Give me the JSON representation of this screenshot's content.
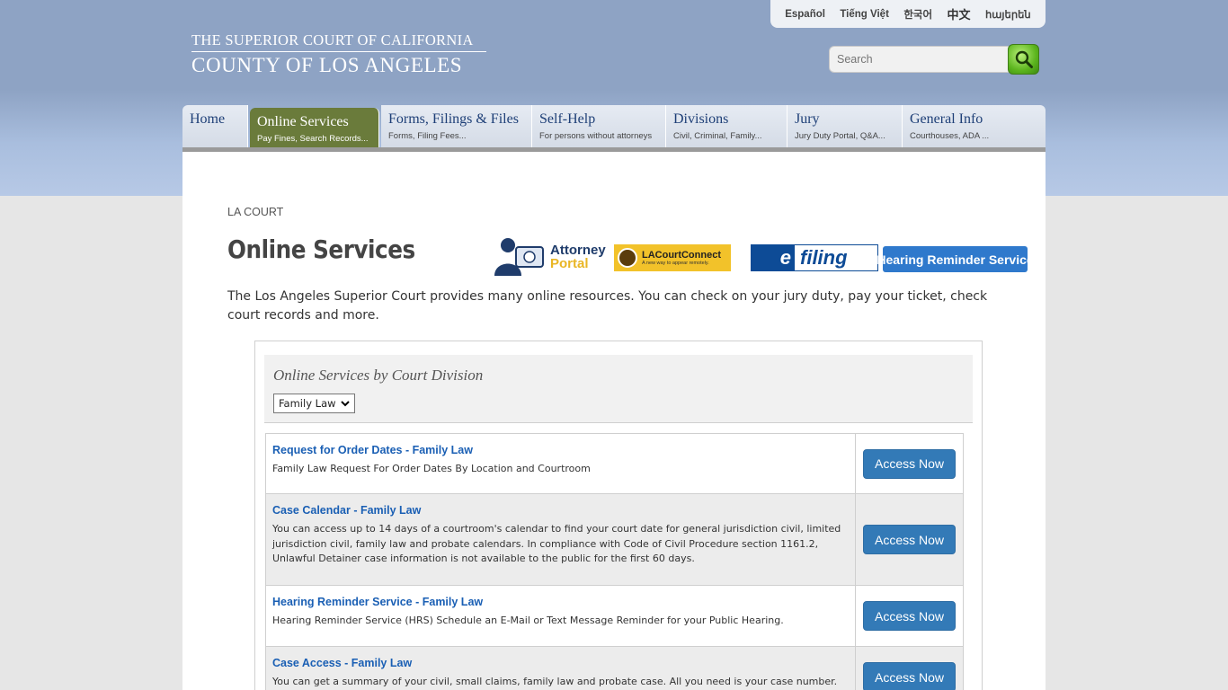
{
  "languages": [
    "Español",
    "Tiếng Việt",
    "한국어",
    "中文",
    "հայերեն"
  ],
  "logo": {
    "line1": "THE SUPERIOR COURT OF CALIFORNIA",
    "line2": "COUNTY OF LOS ANGELES"
  },
  "search": {
    "placeholder": "Search"
  },
  "nav": [
    {
      "title": "Home",
      "sub": ""
    },
    {
      "title": "Online Services",
      "sub": "Pay Fines, Search Records..."
    },
    {
      "title": "Forms, Filings & Files",
      "sub": "Forms, Filing Fees..."
    },
    {
      "title": "Self-Help",
      "sub": "For persons without attorneys"
    },
    {
      "title": "Divisions",
      "sub": "Civil, Criminal, Family..."
    },
    {
      "title": "Jury",
      "sub": "Jury Duty Portal, Q&A..."
    },
    {
      "title": "General Info",
      "sub": "Courthouses, ADA ..."
    }
  ],
  "breadcrumb": "LA COURT",
  "page_title": "Online Services",
  "intro": "The Los Angeles Superior Court provides many online resources. You can check on your jury duty, pay your ticket, check court records and more.",
  "quick_links": {
    "attorney_line1": "Attorney",
    "attorney_line2": "Portal",
    "lacc_title": "LACourtConnect",
    "lacc_tagline": "A new way to appear remotely.",
    "efiling_e": "e",
    "efiling_rest": "filing",
    "hrs": "Hearing Reminder Service"
  },
  "division_panel": {
    "title": "Online Services by Court Division",
    "selected": "Family Law"
  },
  "services": [
    {
      "title": "Request for Order Dates - Family Law",
      "desc": "Family Law Request For Order Dates By Location and Courtroom",
      "button": "Access Now"
    },
    {
      "title": "Case Calendar - Family Law",
      "desc": "You can access up to 14 days of a courtroom's calendar to find your court date for general jurisdiction civil, limited jurisdiction civil, family law and probate calendars. In compliance with Code of Civil Procedure section 1161.2, Unlawful Detainer case information is not available to the public for the first 60 days.",
      "button": "Access Now"
    },
    {
      "title": "Hearing Reminder Service - Family Law",
      "desc": "Hearing Reminder Service (HRS) Schedule an E-Mail or Text Message Reminder for your Public Hearing.",
      "button": "Access Now"
    },
    {
      "title": "Case Access - Family Law",
      "desc": "You can get a summary of your civil, small claims, family law and probate case. All you need is your case number.",
      "button": "Access Now"
    }
  ]
}
